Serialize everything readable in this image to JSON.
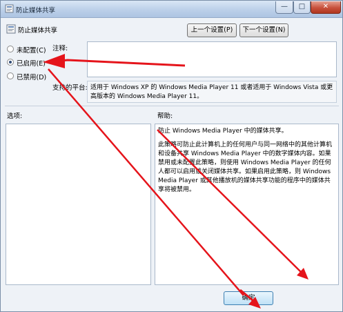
{
  "window": {
    "title": "防止媒体共享",
    "minimize_glyph": "—",
    "maximize_glyph": "□",
    "close_glyph": "✕"
  },
  "header": {
    "policy_name": "防止媒体共享"
  },
  "nav": {
    "prev_label": "上一个设置(P)",
    "next_label": "下一个设置(N)"
  },
  "state": {
    "options": [
      {
        "label": "未配置(C)",
        "selected": false
      },
      {
        "label": "已启用(E)",
        "selected": true
      },
      {
        "label": "已禁用(D)",
        "selected": false
      }
    ]
  },
  "comment": {
    "label": "注释:",
    "value": ""
  },
  "platform": {
    "label": "支持的平台:",
    "text": "适用于 Windows XP 的 Windows Media Player 11 或者适用于 Windows Vista 或更高版本的 Windows Media Player 11。"
  },
  "options_panel": {
    "label": "选项:"
  },
  "help": {
    "label": "帮助:",
    "paragraph1": "防止 Windows Media Player 中的媒体共享。",
    "paragraph2": "此策略可防止此计算机上的任何用户与同一网络中的其他计算机和设备共享 Windows Media Player 中的数字媒体内容。如果禁用或未配置此策略，则使用 Windows Media Player 的任何人都可以启用或关闭媒体共享。如果启用此策略，则 Windows Media Player 或其他播放机的媒体共享功能的程序中的媒体共享将被禁用。"
  },
  "footer": {
    "ok_label": "确定"
  },
  "colors": {
    "annotation_arrow": "#e5141b",
    "window_bg": "#eef2f7"
  }
}
